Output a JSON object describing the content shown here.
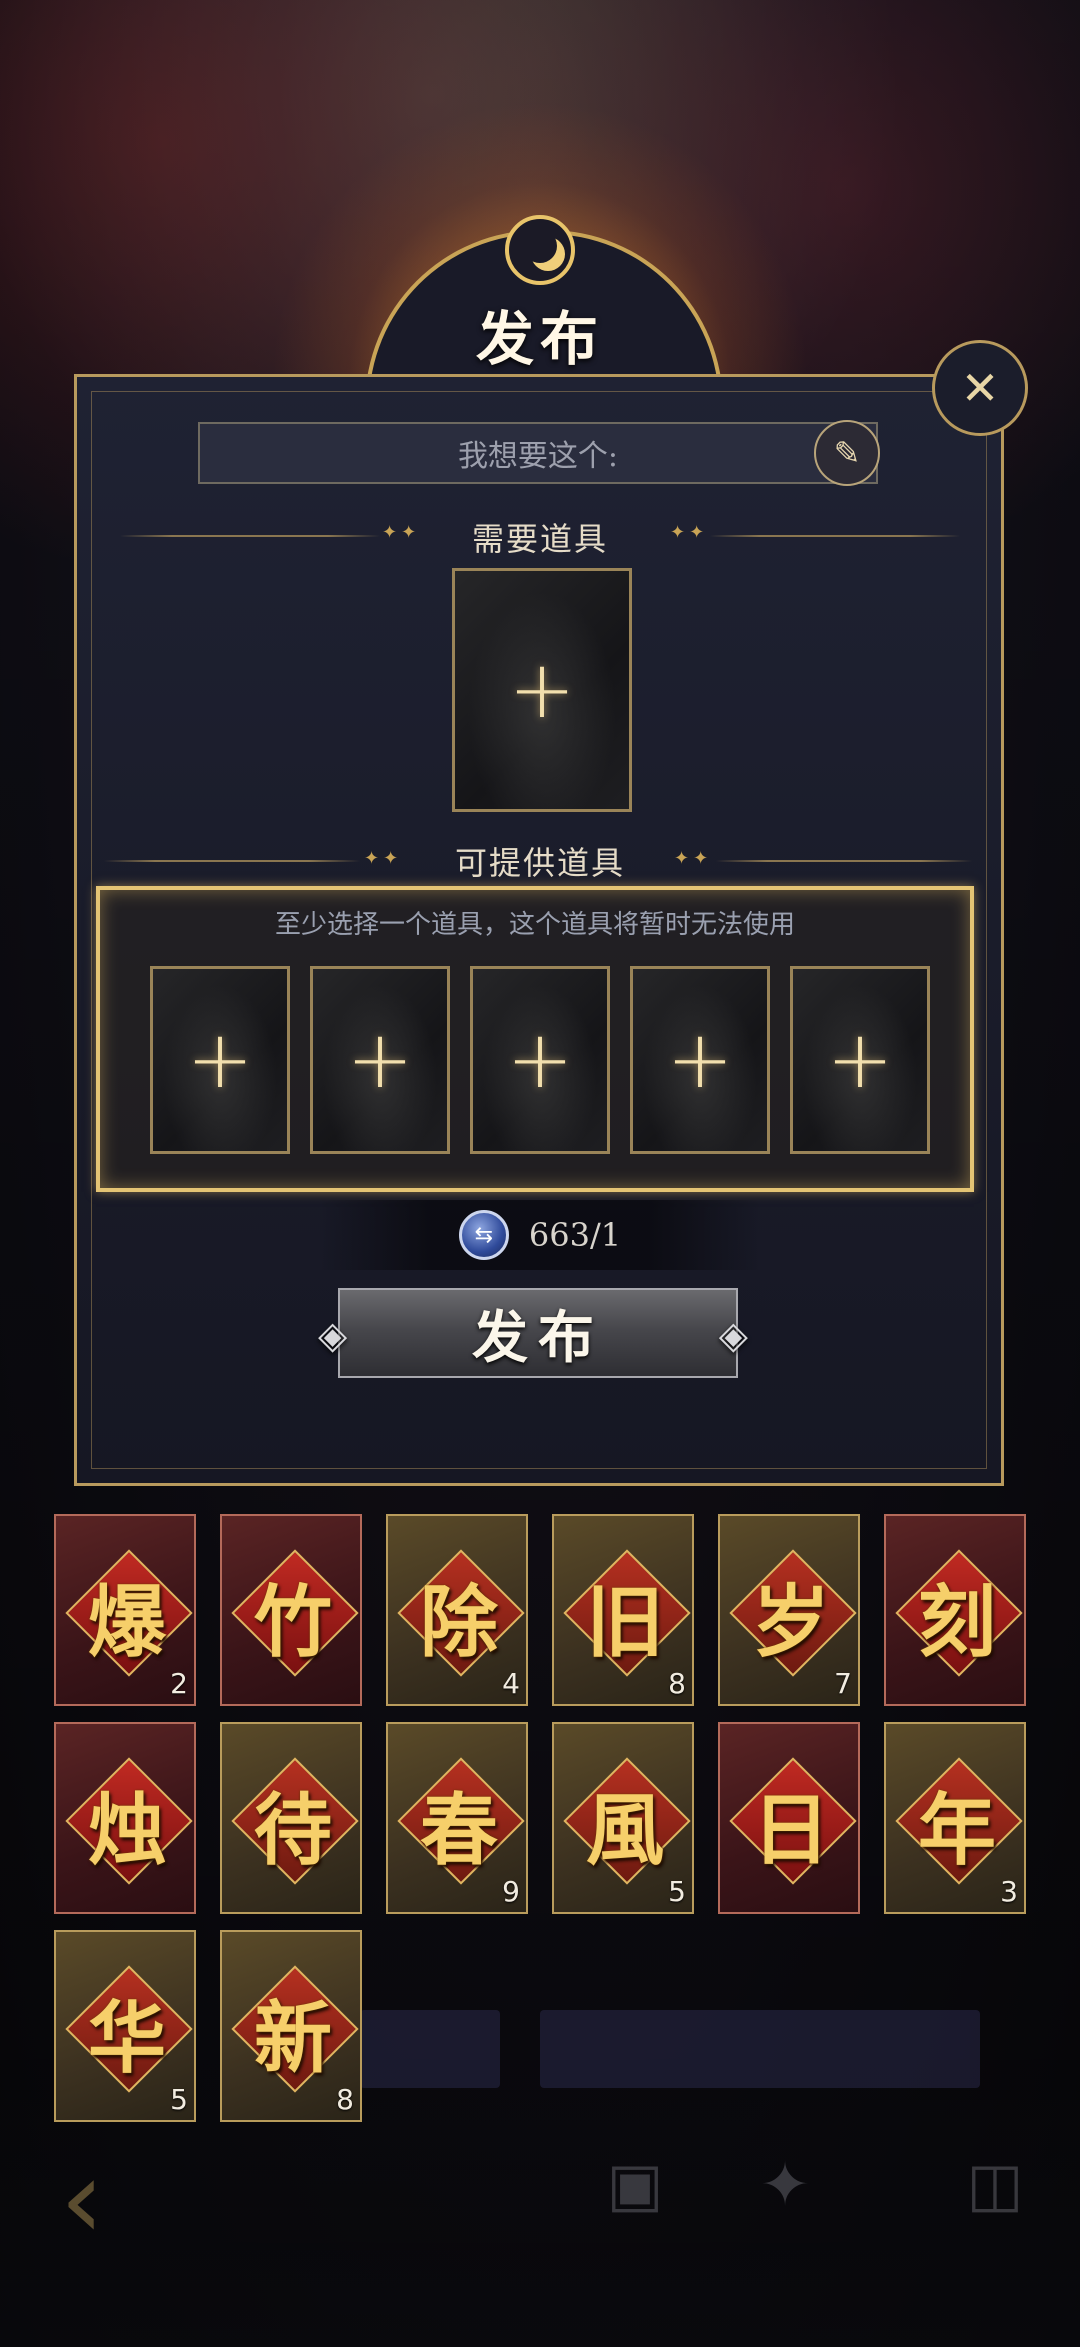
{
  "title": "发布",
  "want_placeholder": "我想要这个:",
  "sections": {
    "required_label": "需要道具",
    "offer_label": "可提供道具",
    "offer_hint": "至少选择一个道具，这个道具将暂时无法使用"
  },
  "required_slots": [
    "+"
  ],
  "offer_slots": [
    "+",
    "+",
    "+",
    "+",
    "+"
  ],
  "cost": {
    "value": "663/1",
    "icon": "swap-coin-icon"
  },
  "publish_label": "发布",
  "close_icon": "close-x-icon",
  "inventory": [
    {
      "glyph": "爆",
      "count": "2",
      "style": "red"
    },
    {
      "glyph": "竹",
      "count": "",
      "style": "red"
    },
    {
      "glyph": "除",
      "count": "4",
      "style": "gold"
    },
    {
      "glyph": "旧",
      "count": "8",
      "style": "gold"
    },
    {
      "glyph": "岁",
      "count": "7",
      "style": "gold"
    },
    {
      "glyph": "刻",
      "count": "",
      "style": "red"
    },
    {
      "glyph": "烛",
      "count": "",
      "style": "red"
    },
    {
      "glyph": "待",
      "count": "",
      "style": "gold"
    },
    {
      "glyph": "春",
      "count": "9",
      "style": "gold"
    },
    {
      "glyph": "風",
      "count": "5",
      "style": "gold"
    },
    {
      "glyph": "日",
      "count": "",
      "style": "red"
    },
    {
      "glyph": "年",
      "count": "3",
      "style": "gold"
    },
    {
      "glyph": "华",
      "count": "5",
      "style": "gold"
    },
    {
      "glyph": "新",
      "count": "8",
      "style": "gold"
    }
  ],
  "colors": {
    "gold": "#c9a456",
    "panel": "#1f2233",
    "glyph": "#f6cf6a"
  }
}
